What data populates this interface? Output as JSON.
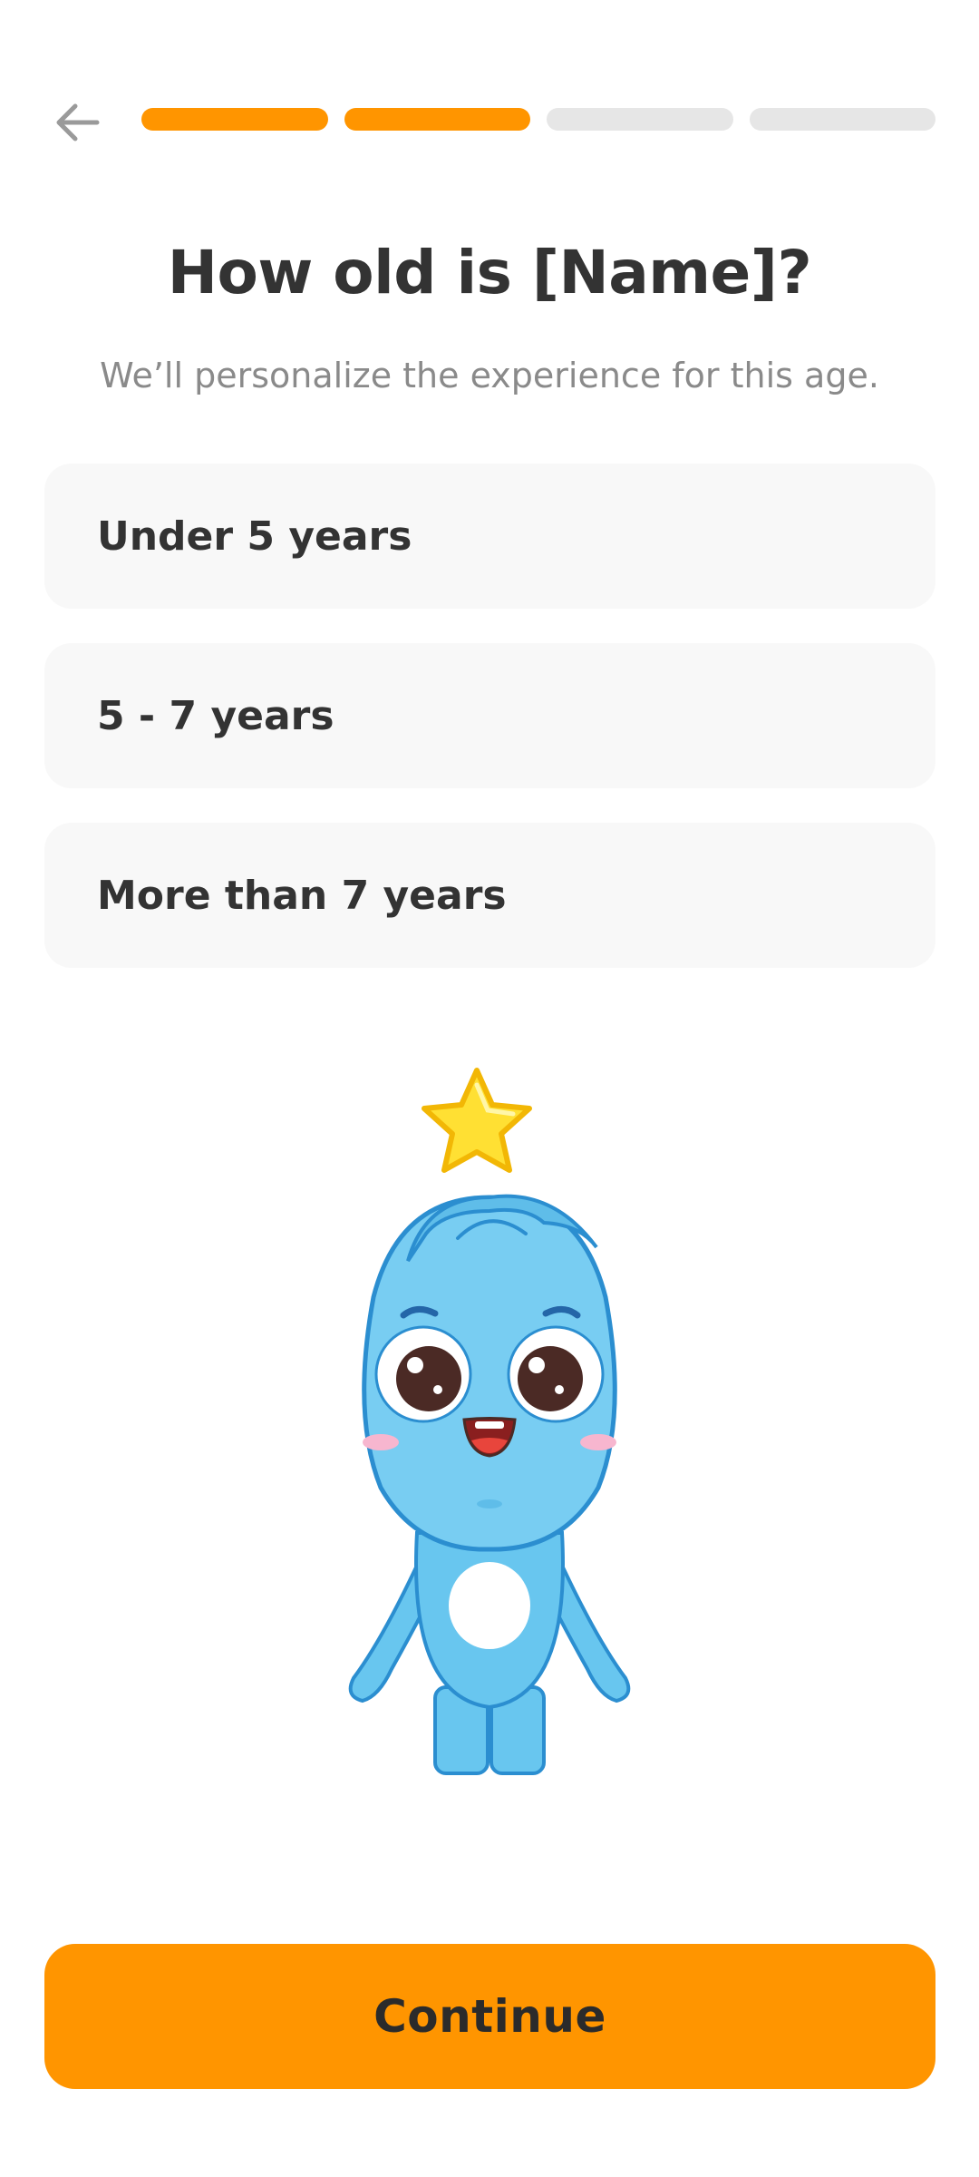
{
  "header": {
    "back_icon": "arrow-left-icon",
    "progress": {
      "total_steps": 4,
      "completed_steps": 2,
      "active_color": "#ff9500",
      "inactive_color": "#e6e6e6"
    }
  },
  "main": {
    "title": "How old is [Name]?",
    "subtitle": "We’ll personalize the experience for this age.",
    "options": [
      {
        "label": "Under 5 years"
      },
      {
        "label": "5 - 7 years"
      },
      {
        "label": "More than 7 years"
      }
    ],
    "mascot_icon": "blue-mascot-with-star"
  },
  "footer": {
    "continue_label": "Continue",
    "accent_color": "#ff9500"
  }
}
